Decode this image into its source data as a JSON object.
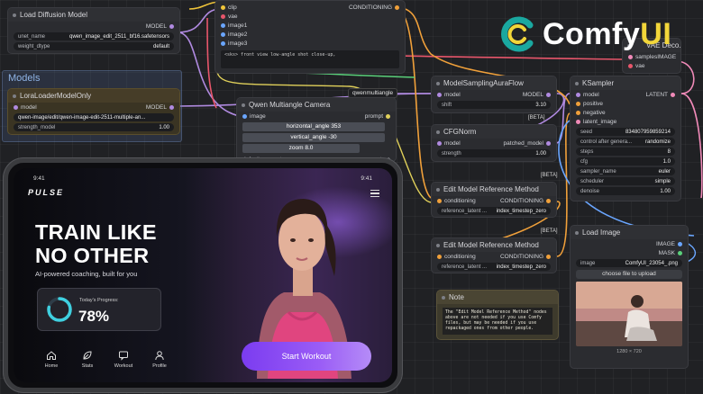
{
  "brand": {
    "logo_text_main": "Comfy",
    "logo_text_accent": "UI",
    "accent_color": "#f2d63a",
    "mark_color": "#1aa8a0"
  },
  "nodes": {
    "load_diffusion": {
      "title": "Load Diffusion Model",
      "output": "MODEL",
      "unet_label": "unet_name",
      "unet_value": "qwen_image_edit_2511_bf16.safetensors",
      "dtype_label": "weight_dtype",
      "dtype_value": "default"
    },
    "group_models": {
      "title": "Models"
    },
    "lora": {
      "title": "LoraLoaderModelOnly",
      "input": "model",
      "output": "MODEL",
      "lora_value": "qwen-image/edit/qwen-image-edit-2511-multiple-an...",
      "strength_label": "strength_model",
      "strength_value": "1.00"
    },
    "encoder": {
      "inputs": [
        "clip",
        "vae",
        "image1",
        "image2",
        "image3"
      ],
      "output": "CONDITIONING",
      "prompt_text": "<sks> front view low-angle shot close-up,"
    },
    "multiangle": {
      "title": "Qwen Multiangle Camera",
      "input": "image",
      "output": "prompt",
      "output_badge": "qwenmultiangle",
      "horizontal": "horizontal_angle  353",
      "vertical": "vertical_angle  -30",
      "zoom": "zoom  8.0",
      "default_prompts": "default_prompts",
      "default_prompts_value": "true"
    },
    "model_sampling": {
      "title": "ModelSamplingAuraFlow",
      "input": "model",
      "output": "MODEL",
      "shift_label": "shift",
      "shift_value": "3.10"
    },
    "cfgnorm": {
      "title": "CFGNorm",
      "input": "model",
      "output": "patched_model",
      "strength_label": "strength",
      "strength_value": "1.00"
    },
    "vae_decode": {
      "title": "VAE Deco...",
      "inputs": [
        "samples",
        "vae"
      ],
      "output": "IMAGE"
    },
    "ksampler": {
      "title": "KSampler",
      "inputs": [
        "model",
        "positive",
        "negative",
        "latent_image"
      ],
      "output": "LATENT",
      "seed_label": "seed",
      "seed_value": "834807959859214",
      "control_label": "control after genera...",
      "control_value": "randomize",
      "steps_label": "steps",
      "steps_value": "8",
      "cfg_label": "cfg",
      "cfg_value": "1.0",
      "sampler_label": "sampler_name",
      "sampler_value": "euler",
      "scheduler_label": "scheduler",
      "scheduler_value": "simple",
      "denoise_label": "denoise",
      "denoise_value": "1.00"
    },
    "edit_ref_1": {
      "title": "Edit Model Reference Method",
      "badge": "[BETA]",
      "input": "conditioning",
      "output": "CONDITIONING",
      "ref_label": "reference_latent ...",
      "ref_value": "index_timestep_zero"
    },
    "edit_ref_2": {
      "title": "Edit Model Reference Method",
      "badge": "[BETA]",
      "input": "conditioning",
      "output": "CONDITIONING",
      "ref_label": "reference_latent ...",
      "ref_value": "index_timestep_zero"
    },
    "beta_top": {
      "badge": "[BETA]"
    },
    "note": {
      "title": "Note",
      "text": "The \"Edit Model Reference Method\" nodes above are not needed if you use Comfy files, but may be needed if you use repackaged ones from other people."
    },
    "load_image": {
      "title": "Load Image",
      "outputs": [
        "IMAGE",
        "MASK"
      ],
      "image_label": "image",
      "image_value": "ComfyUI_23054_.png",
      "upload_label": "choose file to upload",
      "caption": "1280 × 720"
    }
  },
  "tablet": {
    "time_left": "9:41",
    "time_right": "9:41",
    "brand": "PULSE",
    "headline_line1": "TRAIN LIKE",
    "headline_line2": "NO OTHER",
    "subtitle": "AI-powered coaching, built for you",
    "progress_label": "Today's Progress:",
    "progress_value": "78%",
    "progress_fraction": 0.78,
    "cta_label": "Start Workout",
    "tabs": [
      {
        "label": "Home",
        "icon": "home-icon"
      },
      {
        "label": "Stats",
        "icon": "leaf-icon"
      },
      {
        "label": "Workout",
        "icon": "chat-icon"
      },
      {
        "label": "Profile",
        "icon": "user-icon"
      }
    ]
  }
}
